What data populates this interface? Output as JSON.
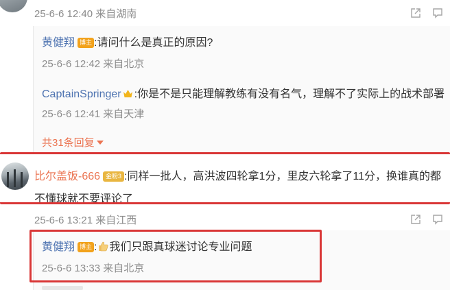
{
  "comment1": {
    "meta": "25-6-6 12:40 来自湖南"
  },
  "reply1": {
    "author": "黄健翔",
    "badge": "博主",
    "text": ":请问什么是真正的原因?",
    "meta": "25-6-6 12:42 来自北京"
  },
  "reply2": {
    "author": "CaptainSpringer",
    "text": ":你是不是只能理解教练有没有名气，理解不了实际上的战术部署",
    "meta": "25-6-6 12:41 来自天津"
  },
  "more_replies": "共31条回复",
  "comment2": {
    "author": "比尔盖饭-666",
    "badge": "金粉3",
    "text_line1": ":同样一批人，高洪波四轮拿1分，里皮六轮拿了11分，换谁真的都",
    "text_line2": "不懂球就不要评论了",
    "meta": "25-6-6 13:21 来自江西"
  },
  "reply3": {
    "author": "黄健翔",
    "badge": "博主",
    "text": "我们只跟真球迷讨论专业问题",
    "meta": "25-6-6 13:33 来自北京"
  },
  "icons": [
    "share-icon",
    "comment-icon",
    "like-icon",
    "thumbs-up-emoji",
    "crown-icon"
  ],
  "colors": {
    "highlight_border": "#d93636",
    "author": "#eb7350",
    "link": "#4f74b1",
    "meta": "#8b8b8b"
  }
}
